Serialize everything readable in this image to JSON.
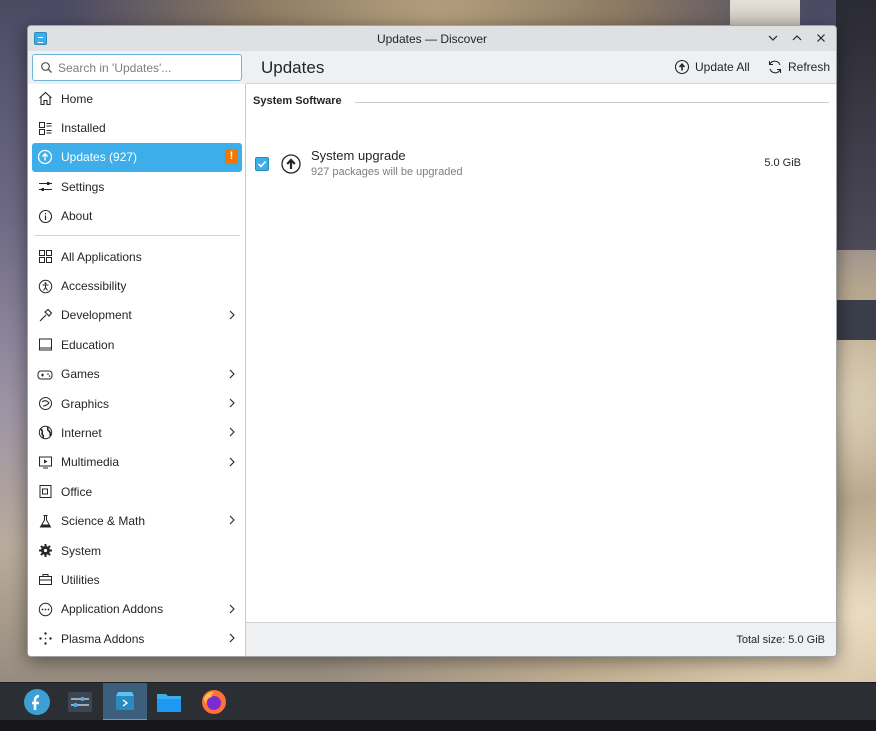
{
  "window": {
    "title": "Updates — Discover",
    "controls": [
      "chevron-down-icon",
      "chevron-up-icon",
      "close-icon"
    ]
  },
  "search": {
    "placeholder": "Search in 'Updates'..."
  },
  "sidebar": {
    "primary": [
      {
        "label": "Home",
        "icon": "home-icon"
      },
      {
        "label": "Installed",
        "icon": "installed-icon"
      },
      {
        "label": "Updates (927)",
        "icon": "updates-icon",
        "active": true,
        "badge": "!"
      },
      {
        "label": "Settings",
        "icon": "settings-icon"
      },
      {
        "label": "About",
        "icon": "info-icon"
      }
    ],
    "categories": [
      {
        "label": "All Applications",
        "icon": "grid-icon",
        "chevron": false
      },
      {
        "label": "Accessibility",
        "icon": "accessibility-icon",
        "chevron": false
      },
      {
        "label": "Development",
        "icon": "hammer-icon",
        "chevron": true
      },
      {
        "label": "Education",
        "icon": "education-icon",
        "chevron": false
      },
      {
        "label": "Games",
        "icon": "gamepad-icon",
        "chevron": true
      },
      {
        "label": "Graphics",
        "icon": "palette-icon",
        "chevron": true
      },
      {
        "label": "Internet",
        "icon": "globe-icon",
        "chevron": true
      },
      {
        "label": "Multimedia",
        "icon": "multimedia-icon",
        "chevron": true
      },
      {
        "label": "Office",
        "icon": "office-icon",
        "chevron": false
      },
      {
        "label": "Science & Math",
        "icon": "flask-icon",
        "chevron": true
      },
      {
        "label": "System",
        "icon": "gear-icon",
        "chevron": false
      },
      {
        "label": "Utilities",
        "icon": "toolbox-icon",
        "chevron": false
      },
      {
        "label": "Application Addons",
        "icon": "addons-icon",
        "chevron": true
      },
      {
        "label": "Plasma Addons",
        "icon": "plasma-icon",
        "chevron": true
      }
    ]
  },
  "main": {
    "title": "Updates",
    "update_all_label": "Update All",
    "refresh_label": "Refresh",
    "section_title": "System Software",
    "update": {
      "name": "System upgrade",
      "description": "927 packages will be upgraded",
      "size": "5.0 GiB",
      "checked": true
    },
    "total_size": "Total size: 5.0 GiB"
  },
  "taskbar": {
    "items": [
      "fedora-launcher-icon",
      "system-settings-icon",
      "discover-icon",
      "file-manager-icon",
      "firefox-icon"
    ],
    "active": "discover-icon"
  },
  "colors": {
    "accent": "#3daee9",
    "badge": "#f67400",
    "taskbar": "#2b2e33"
  }
}
